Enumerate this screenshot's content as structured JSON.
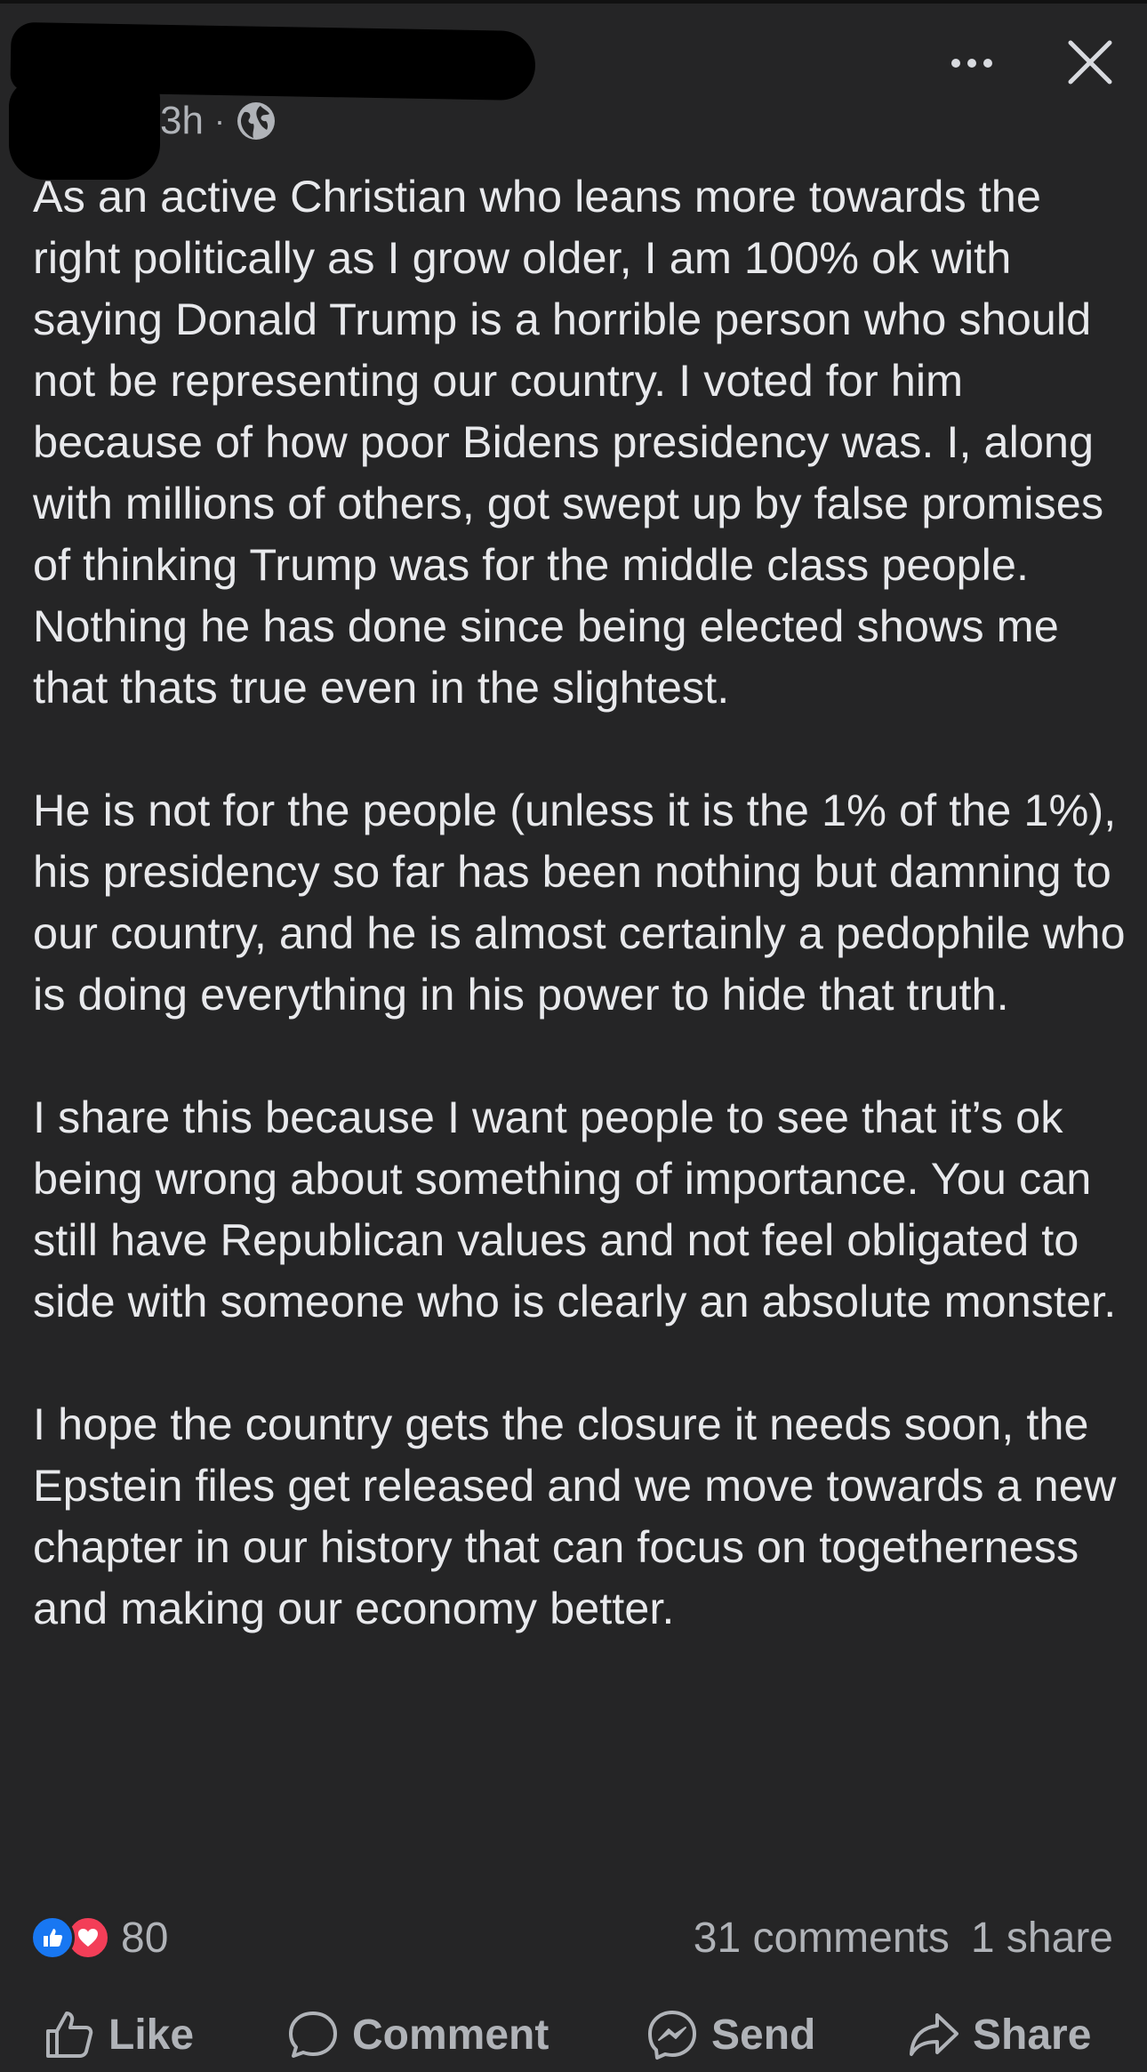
{
  "post": {
    "timestamp": "3h",
    "separator": "·",
    "audience_icon": "globe-icon",
    "paragraphs": [
      "As an active Christian who leans more towards the right politically as I grow older, I am 100% ok with saying Donald Trump is a horrible person who should not be representing our country. I voted for him because of how poor Bidens presidency was. I, along with millions of others, got swept up by false promises of thinking Trump was for the middle class people. Nothing he has done since being elected shows me that thats true even in the slightest.",
      "He is not for the people (unless it is the 1% of the 1%), his presidency so far has been nothing but damning to our country, and he is almost certainly a pedophile who is doing everything in his power to hide that truth.",
      "I share this because I want people to see that it’s ok being wrong about something of importance. You can still have Republican values and not feel obligated to side with someone who is clearly an absolute monster.",
      "I hope the country gets the closure it needs soon, the Epstein files get released and we move towards a new chapter in our history that can focus on togetherness and making our economy better."
    ]
  },
  "reactions": {
    "count": "80",
    "icons": [
      "like-icon",
      "love-icon"
    ]
  },
  "stats": {
    "comments": "31 comments",
    "shares": "1 share"
  },
  "actions": {
    "like": "Like",
    "comment": "Comment",
    "send": "Send",
    "share": "Share"
  },
  "colors": {
    "background": "#252526",
    "text": "#e8e9ec",
    "secondary_text": "#b0b3b8",
    "like_blue": "#1877f2",
    "love_red": "#f33e58"
  }
}
